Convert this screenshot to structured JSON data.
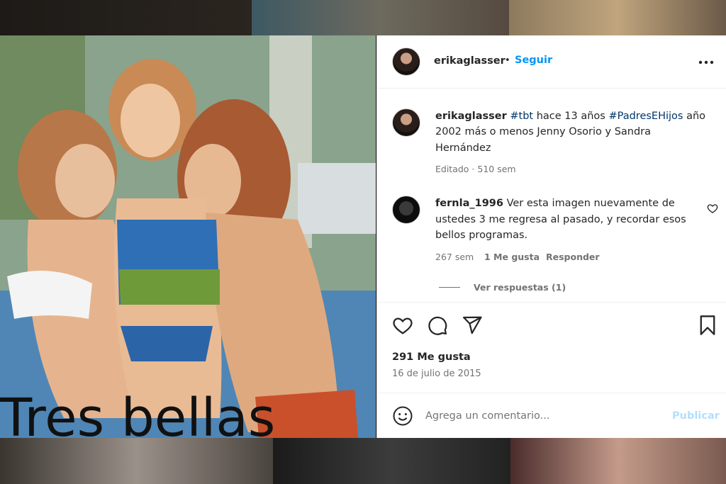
{
  "post": {
    "username": "erikaglasser",
    "follow_separator": "•",
    "follow_label": "Seguir",
    "photo_overlay_text": "Tres bellas",
    "caption": {
      "username": "erikaglasser",
      "tag1": "#tbt",
      "text1": "hace 13 años",
      "tag2": "#PadresEHijos",
      "text2": "año",
      "line2": "2002 más o menos Jenny Osorio y Sandra",
      "line3": "Hernández",
      "meta": "Editado · 510 sem"
    },
    "comments": [
      {
        "username": "fernla_1996",
        "line1": "Ver esta imagen nuevamente de",
        "line2": "ustedes 3 me regresa al pasado, y recordar esos",
        "line3": "bellos programas.",
        "time": "267 sem",
        "likes": "1 Me gusta",
        "reply_label": "Responder",
        "view_replies": "Ver respuestas (1)"
      }
    ],
    "likes_count": "291 Me gusta",
    "date": "16 de julio de 2015",
    "comment_placeholder": "Agrega un comentario...",
    "publish_label": "Publicar",
    "icons": {
      "more": "more-options-icon",
      "heart": "heart-icon",
      "comment": "comment-icon",
      "share": "share-icon",
      "save": "bookmark-icon",
      "emoji": "emoji-icon"
    },
    "colors": {
      "accent": "#0095f6",
      "hashtag": "#00376b",
      "muted": "#737373",
      "publish_disabled": "#b2dffc"
    }
  }
}
